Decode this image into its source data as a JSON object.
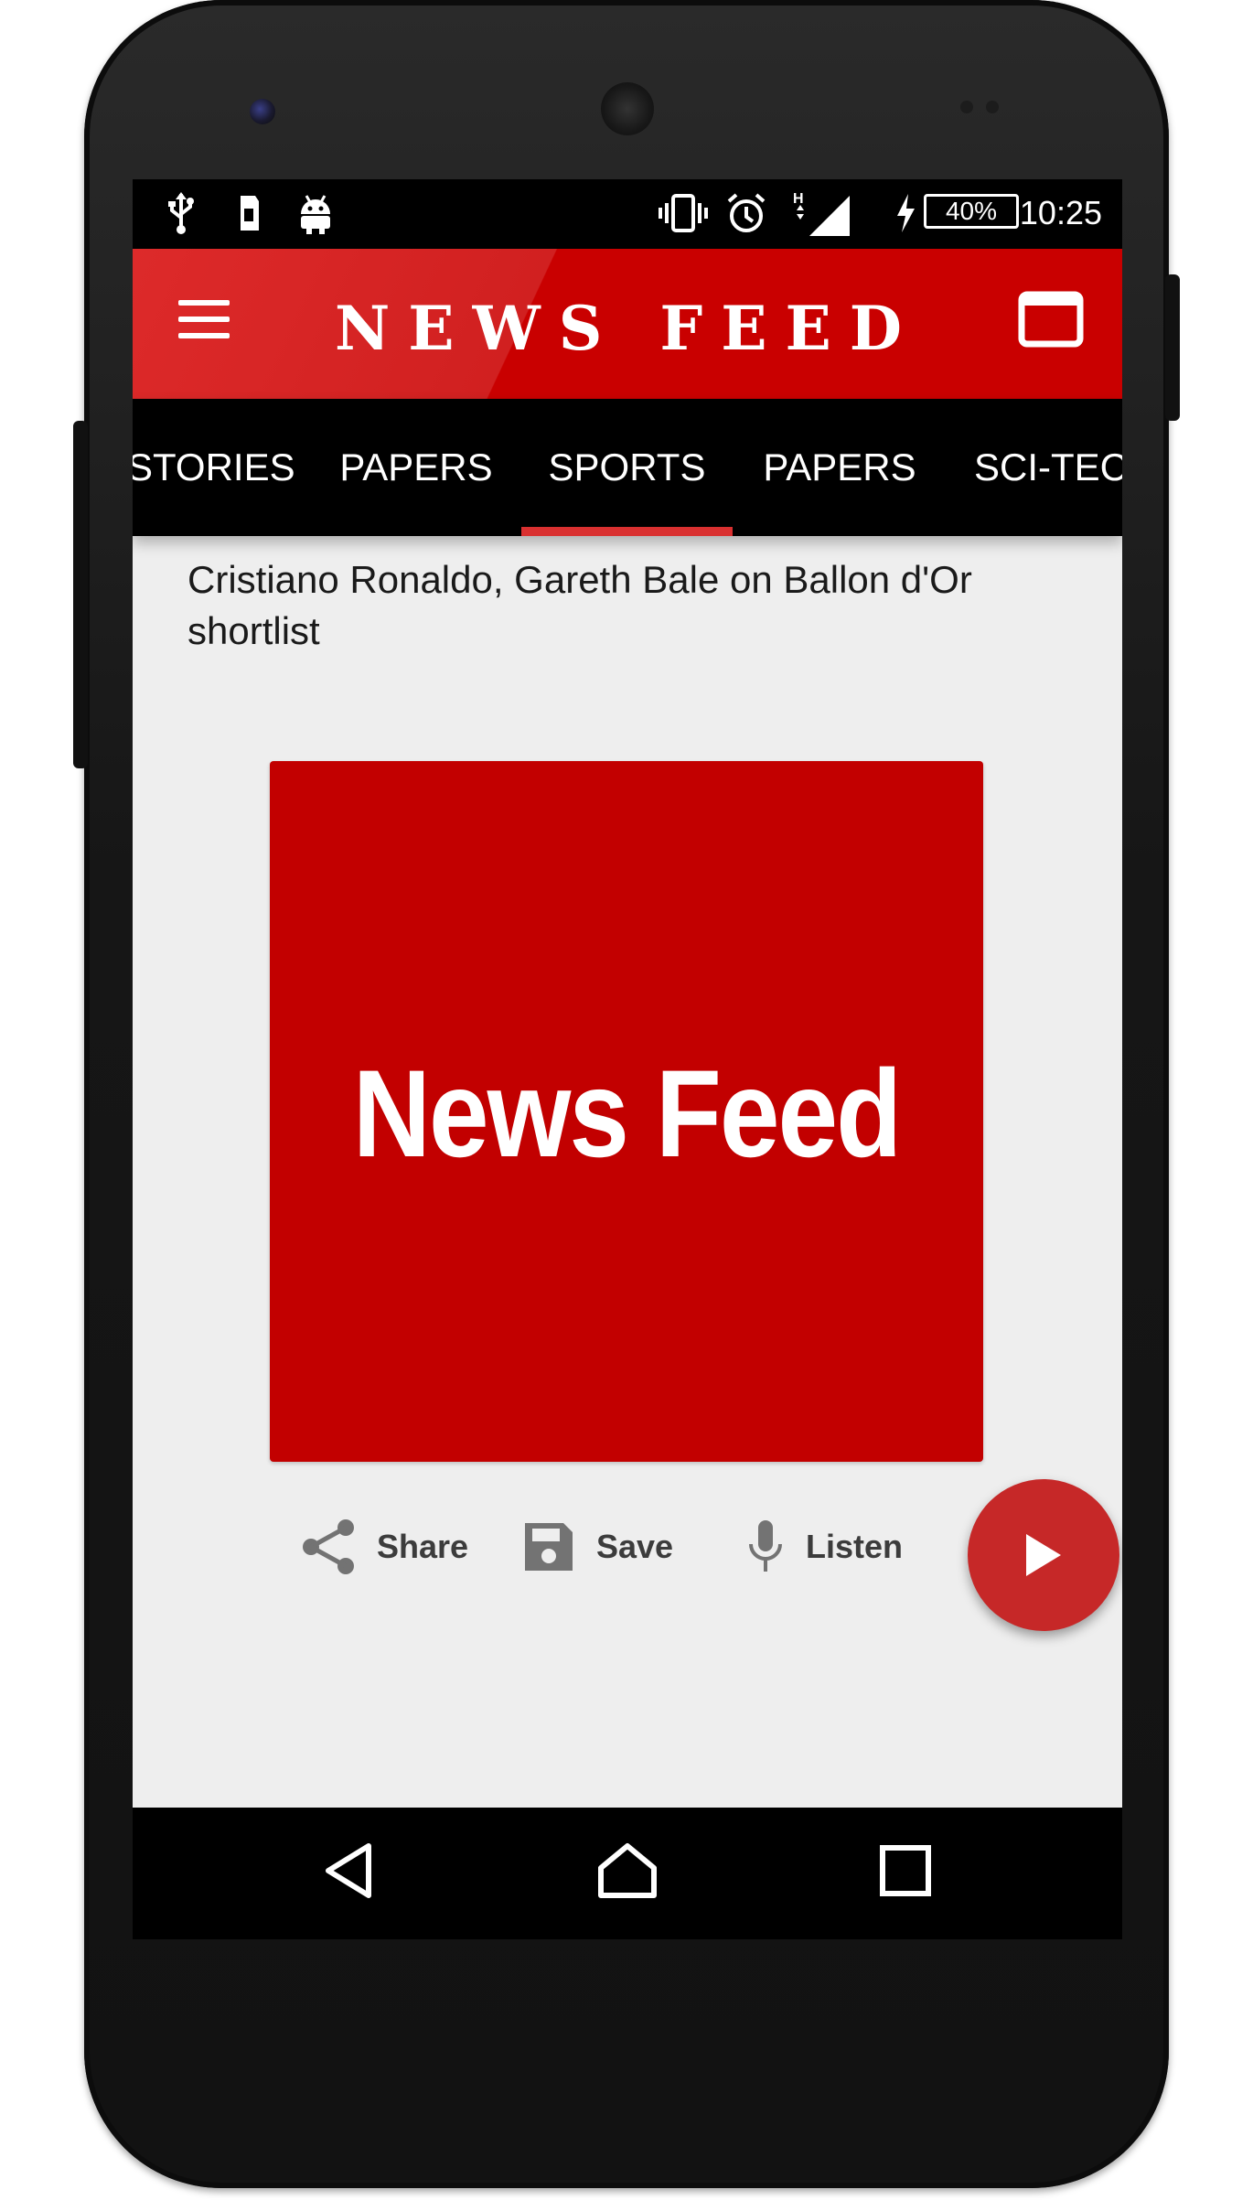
{
  "status_bar": {
    "time": "10:25",
    "battery": "40%",
    "network_type": "H",
    "left_icons": [
      "usb-icon",
      "sd-card-icon",
      "android-icon"
    ],
    "right_icons": [
      "vibrate-icon",
      "alarm-icon",
      "signal-icon",
      "charging-icon"
    ]
  },
  "app_bar": {
    "title": "NEWS FEED"
  },
  "tabs": [
    {
      "label": "STORIES"
    },
    {
      "label": "PAPERS"
    },
    {
      "label": "SPORTS",
      "selected": true
    },
    {
      "label": "PAPERS"
    },
    {
      "label": "SCI-TECH"
    }
  ],
  "article": {
    "headline": "Cristiano Ronaldo, Gareth Bale on Ballon d'Or shortlist",
    "image_text": "News Feed"
  },
  "actions": {
    "share_label": "Share",
    "save_label": "Save",
    "listen_label": "Listen"
  },
  "colors": {
    "brand_red": "#c90000",
    "tab_indicator": "#d93030",
    "fab": "#c62828"
  }
}
